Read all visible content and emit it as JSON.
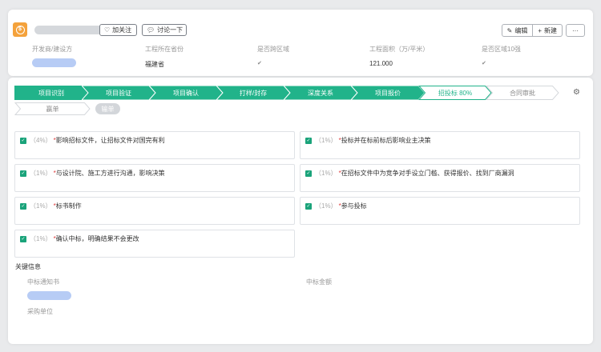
{
  "header": {
    "follow_label": "加关注",
    "discuss_label": "讨论一下",
    "edit_label": "编辑",
    "new_label": "新建",
    "more_label": "···"
  },
  "fields": {
    "developer_label": "开发商/建设方",
    "province_label": "工程所在省份",
    "province_value": "福建省",
    "cross_region_label": "是否跨区域",
    "area_label": "工程面积（万/平米）",
    "area_value": "121.000",
    "region10_label": "是否区域10强"
  },
  "pipeline": {
    "stages": [
      {
        "label": "项目识别",
        "state": "done"
      },
      {
        "label": "项目验证",
        "state": "done"
      },
      {
        "label": "项目确认",
        "state": "done"
      },
      {
        "label": "打样/封存",
        "state": "done"
      },
      {
        "label": "深度关系",
        "state": "done"
      },
      {
        "label": "项目报价",
        "state": "done"
      },
      {
        "label": "招投标 80%",
        "state": "current"
      },
      {
        "label": "合同审批",
        "state": "todo"
      }
    ],
    "lose_stage_label": "赢单",
    "lose_button_label": "输单"
  },
  "tasks": [
    {
      "pct": "（4%）",
      "text": "影响招标文件，让招标文件对国完有利"
    },
    {
      "pct": "（1%）",
      "text": "投标并在标前标后影响业主决策"
    },
    {
      "pct": "（1%）",
      "text": "与设计院、施工方进行沟通，影响决策"
    },
    {
      "pct": "（1%）",
      "text": "在招标文件中为竞争对手设立门槛、获得报价、找到厂商漏洞"
    },
    {
      "pct": "（1%）",
      "text": "标书制作"
    },
    {
      "pct": "（1%）",
      "text": "参与投标"
    },
    {
      "pct": "（1%）",
      "text": "确认中标，明确结果不会更改"
    }
  ],
  "key_info": {
    "title": "关键信息",
    "win_notice_label": "中标通知书",
    "win_amount_label": "中标金额",
    "purchaser_label": "采购单位"
  },
  "colors": {
    "accent": "#21b38a",
    "done_stage": "#21b38a",
    "app_icon": "#f4a23c",
    "placeholder_blue": "#b7ccf5",
    "required_star": "#e03b3b"
  },
  "icons": {
    "app": "coin-icon",
    "follow": "heart-icon",
    "discuss": "comment-icon",
    "edit": "pencil-icon",
    "new": "plus-icon",
    "settings": "gear-icon",
    "task_check": "checkbox-checked-icon"
  }
}
